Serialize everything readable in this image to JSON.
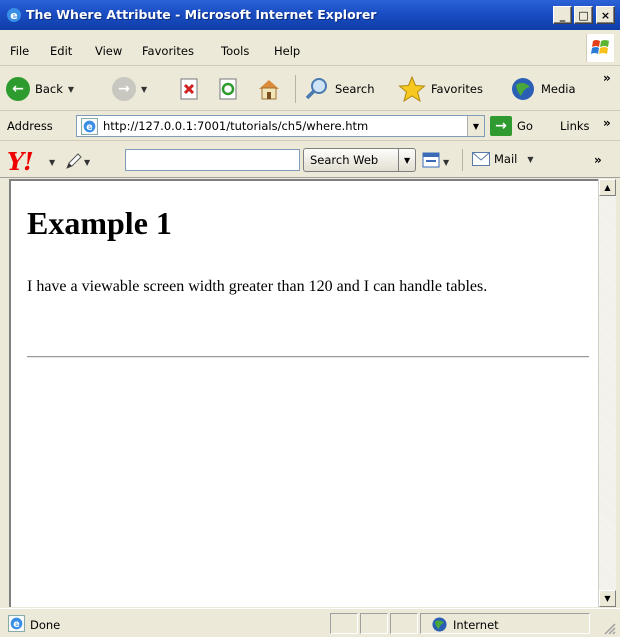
{
  "window": {
    "title": "The Where Attribute - Microsoft Internet Explorer",
    "min_glyph": "_",
    "max_glyph": "□",
    "close_glyph": "×"
  },
  "menu": {
    "items": [
      "File",
      "Edit",
      "View",
      "Favorites",
      "Tools",
      "Help"
    ]
  },
  "toolbar": {
    "back_label": "Back",
    "search_label": "Search",
    "favorites_label": "Favorites",
    "media_label": "Media",
    "more_glyph": "»"
  },
  "address": {
    "label": "Address",
    "url": "http://127.0.0.1:7001/tutorials/ch5/where.htm",
    "go_label": "Go",
    "links_label": "Links",
    "more_glyph": "»"
  },
  "yahoo": {
    "logo": "Y!",
    "search_value": "",
    "search_button": "Search Web",
    "mail_label": "Mail",
    "more_glyph": "»"
  },
  "page": {
    "heading": "Example 1",
    "paragraph": "I have a viewable screen width greater than 120 and I can handle tables."
  },
  "status": {
    "text": "Done",
    "zone": "Internet"
  },
  "colors": {
    "titlebar": "#1c4fc6",
    "chrome": "#ece9d8",
    "yahoo_red": "#e00000"
  }
}
